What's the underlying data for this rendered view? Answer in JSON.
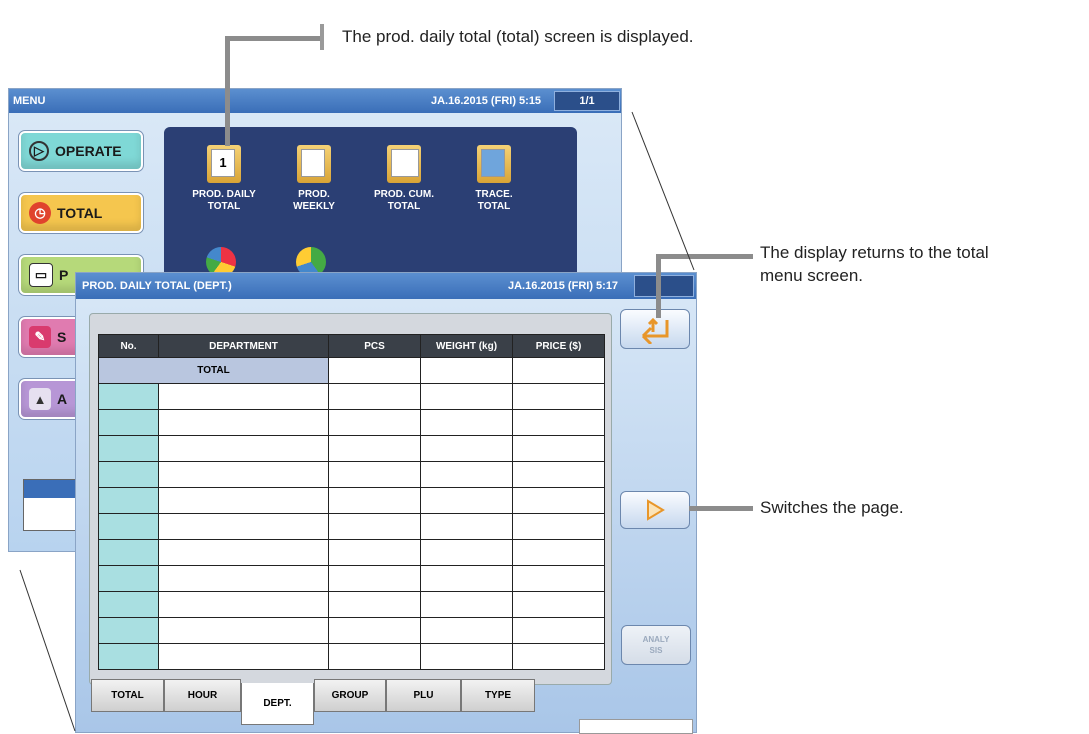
{
  "annotations": {
    "step_number": "1",
    "step_text": "The prod. daily total (total) screen is displayed.",
    "back_text_line1": "The display returns to the total",
    "back_text_line2": "menu screen.",
    "switch_text": "Switches the page."
  },
  "menu_screen": {
    "title": "MENU",
    "datetime": "JA.16.2015 (FRI)  5:15",
    "page": "1/1",
    "side_buttons": [
      {
        "label": "OPERATE",
        "icon": "play-icon",
        "color": "#7fd8d6"
      },
      {
        "label": "TOTAL",
        "icon": "clock-icon",
        "color": "#f5c64e"
      },
      {
        "label": "P",
        "icon": "book-icon",
        "color": "#b6d97a"
      },
      {
        "label": "S",
        "icon": "tools-icon",
        "color": "#e07bb0"
      },
      {
        "label": "A",
        "icon": "adjust-icon",
        "color": "#b796d6"
      }
    ],
    "menu_items": [
      {
        "line1": "PROD. DAILY",
        "line2": "TOTAL",
        "icon": "daily-total-icon"
      },
      {
        "line1": "PROD.",
        "line2": "WEEKLY",
        "icon": "weekly-icon"
      },
      {
        "line1": "PROD. CUM.",
        "line2": "TOTAL",
        "icon": "cumulative-icon"
      },
      {
        "line1": "TRACE.",
        "line2": "TOTAL",
        "icon": "trace-icon"
      }
    ]
  },
  "total_screen": {
    "title": "PROD. DAILY TOTAL (DEPT.)",
    "datetime": "JA.16.2015 (FRI)  5:17",
    "columns": [
      "No.",
      "DEPARTMENT",
      "PCS",
      "WEIGHT (kg)",
      "PRICE ($)"
    ],
    "total_row_label": "TOTAL",
    "tabs": [
      "TOTAL",
      "HOUR",
      "DEPT.",
      "GROUP",
      "PLU",
      "TYPE"
    ],
    "active_tab": "DEPT.",
    "analysis_button": "ANALY\nSIS"
  },
  "colors": {
    "accent_bar": "#3a6eb8",
    "menu_panel": "#2b3f74"
  }
}
